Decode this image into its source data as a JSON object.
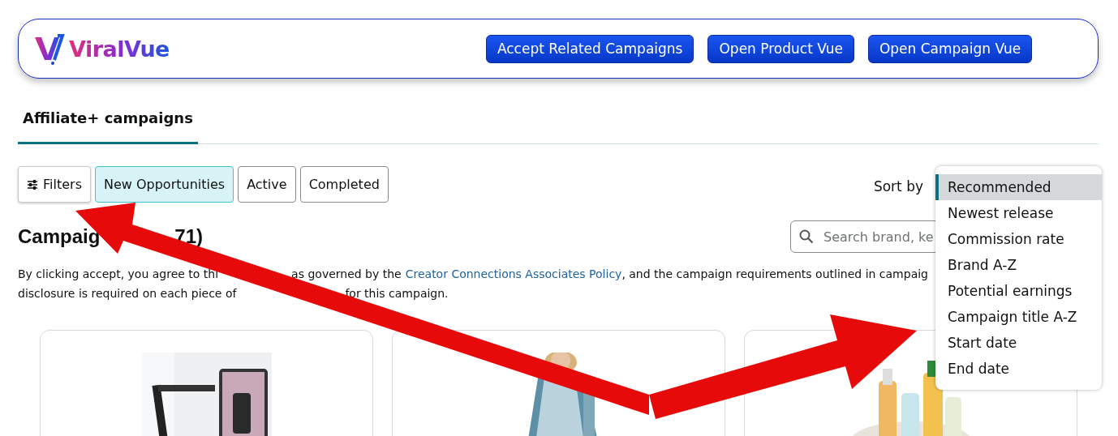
{
  "header": {
    "logo_text": "ViralVue",
    "buttons": [
      "Accept Related Campaigns",
      "Open Product Vue",
      "Open Campaign Vue"
    ]
  },
  "tabs": [
    {
      "label": "Affiliate+ campaigns",
      "selected": true
    }
  ],
  "filters_button": {
    "label": "Filters"
  },
  "status_filters": [
    {
      "label": "New Opportunities",
      "selected": true
    },
    {
      "label": "Active",
      "selected": false
    },
    {
      "label": "Completed",
      "selected": false
    }
  ],
  "sort": {
    "label": "Sort by",
    "options": [
      {
        "label": "Recommended",
        "selected": true
      },
      {
        "label": "Newest release",
        "selected": false
      },
      {
        "label": "Commission rate",
        "selected": false
      },
      {
        "label": "Brand A-Z",
        "selected": false
      },
      {
        "label": "Potential earnings",
        "selected": false
      },
      {
        "label": "Campaign title A-Z",
        "selected": false
      },
      {
        "label": "Start date",
        "selected": false
      },
      {
        "label": "End date",
        "selected": false
      }
    ]
  },
  "search": {
    "placeholder": "Search brand, ke"
  },
  "heading": [
    "Campaig",
    "71)"
  ],
  "notice": {
    "line_1": [
      "By clicking accept, you agree to thi",
      "as governed by the"
    ],
    "link": "Creator Connections Associates Policy",
    "after": ", and the campaign requirements outlined in campaig",
    "line_2": [
      "disclosure is required on each piece of",
      "for this campaign."
    ]
  },
  "cards": [
    {
      "kind": "picture"
    },
    {
      "kind": "picture"
    },
    {
      "kind": "picture"
    }
  ],
  "annotations": [
    {
      "kind": "arrow"
    },
    {
      "kind": "arrow"
    }
  ]
}
